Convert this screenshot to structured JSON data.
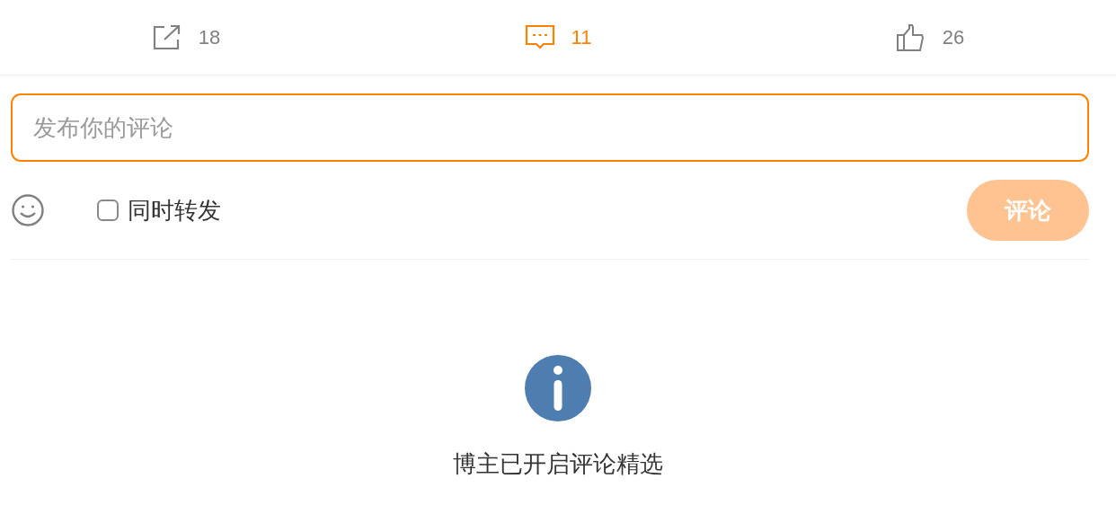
{
  "actions": [
    {
      "kind": "share",
      "count": "18",
      "selected": false
    },
    {
      "kind": "comment",
      "count": "11",
      "selected": true
    },
    {
      "kind": "like",
      "count": "26",
      "selected": false
    }
  ],
  "composer": {
    "placeholder": "发布你的评论",
    "repost": {
      "label": "同时转发",
      "checked": false
    },
    "submit": {
      "label": "评论",
      "disabled": true
    }
  },
  "notice": {
    "text": "博主已开启评论精选"
  }
}
